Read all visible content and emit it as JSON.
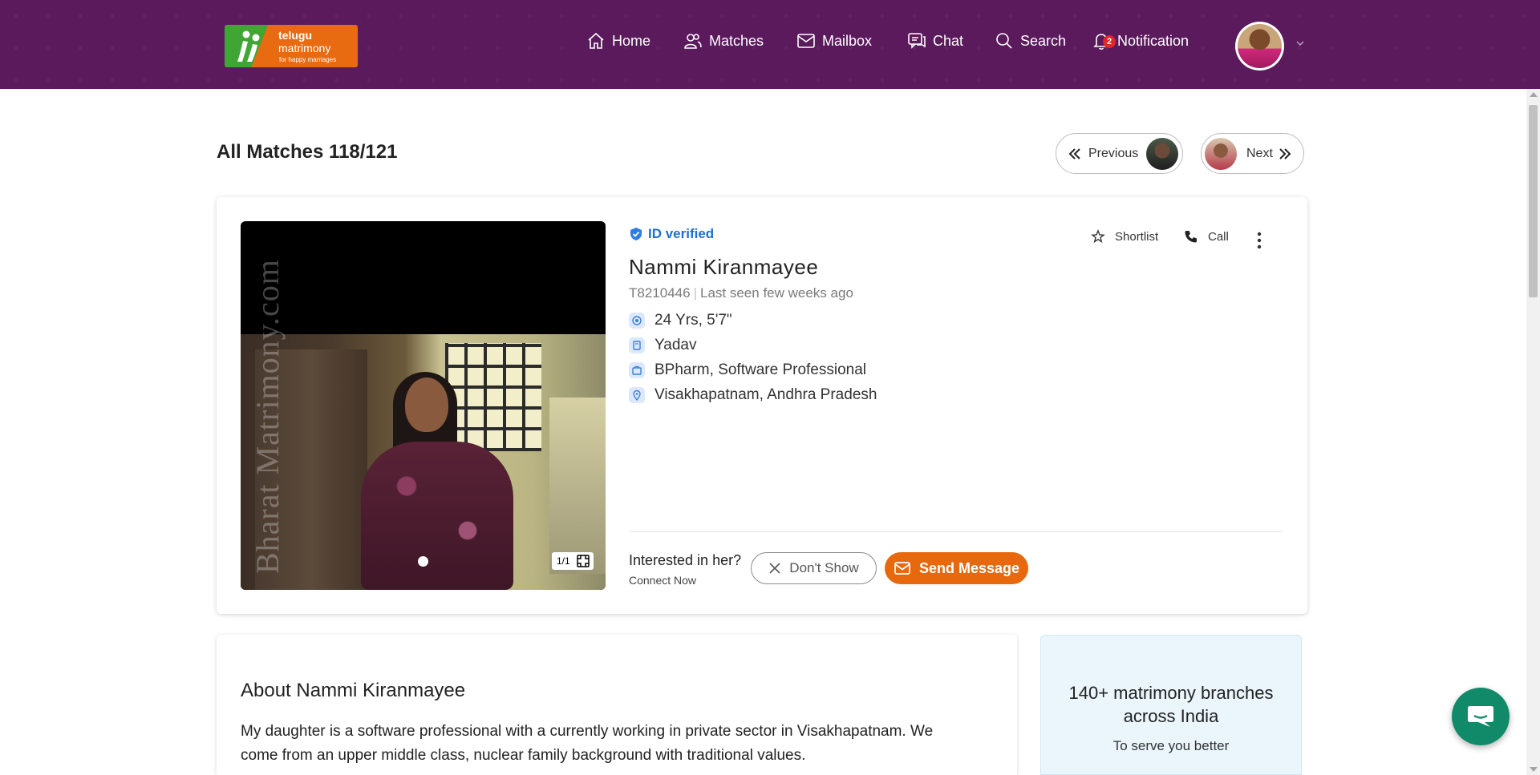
{
  "header": {
    "logo": {
      "line1": "telugu",
      "line2": "matrimony",
      "tagline": "for happy marriages"
    },
    "nav": [
      {
        "label": "Home",
        "icon": "home-icon"
      },
      {
        "label": "Matches",
        "icon": "matches-icon"
      },
      {
        "label": "Mailbox",
        "icon": "mailbox-icon"
      },
      {
        "label": "Chat",
        "icon": "chat-icon"
      },
      {
        "label": "Search",
        "icon": "search-icon"
      },
      {
        "label": "Notification",
        "icon": "bell-icon",
        "badge": "2"
      }
    ]
  },
  "page": {
    "title": "All Matches 118/121",
    "previous_label": "Previous",
    "next_label": "Next"
  },
  "profile": {
    "verified_label": "ID verified",
    "name": "Nammi Kiranmayee",
    "id": "T8210446",
    "last_seen": "Last seen few weeks ago",
    "age_height": "24 Yrs, 5'7\"",
    "community": "Yadav",
    "education_profession": "BPharm, Software Professional",
    "location": "Visakhapatnam, Andhra Pradesh",
    "photo_counter": "1/1",
    "watermark": "Bharat Matrimony.com",
    "actions": {
      "shortlist": "Shortlist",
      "call": "Call"
    },
    "interest_question": "Interested in her?",
    "connect_label": "Connect Now",
    "dont_show_label": "Don't Show",
    "send_message_label": "Send Message"
  },
  "about": {
    "title": "About Nammi Kiranmayee",
    "text": "My daughter is a software professional with a currently working in private sector in Visakhapatnam. We come from an upper middle class, nuclear family background with traditional values."
  },
  "branches": {
    "heading": "140+ matrimony branches across India",
    "subtext": "To serve you better"
  },
  "colors": {
    "header_bg": "#5a1a5c",
    "accent_orange": "#e8690d",
    "verified_blue": "#1f6fd1",
    "chat_green": "#118a6a"
  }
}
